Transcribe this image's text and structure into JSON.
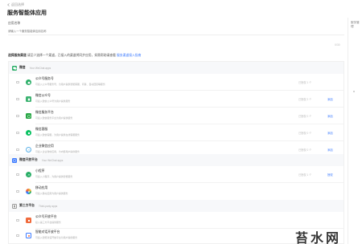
{
  "header": {
    "back_label": "返回选择",
    "title": "服务智能体应用"
  },
  "right_panel": {
    "label": "服务管理"
  },
  "form": {
    "name_label": "应用名称",
    "name_placeholder": "请输入一个服务智能体应用名称",
    "name_count": "0/30"
  },
  "selection": {
    "title": "选择服务渠道",
    "hint": "请至少选择一个渠道，已接入的渠道将同步应用，如需帮助请查看",
    "link": "服务渠道接入指南"
  },
  "groups": [
    {
      "title": "微信",
      "subtitle": "Your WeChat apps",
      "color": "#2aae67",
      "rows": [
        {
          "name": "公众号服务号",
          "desc": "可接入公众号服务号，为用户提供智能客服、问答、自动回复等服务",
          "status": "已授权 1 个",
          "action": "",
          "icon_color": "#2aae67"
        },
        {
          "name": "微信公众号",
          "desc": "可接入微信公众号为用户提供服务",
          "status": "已授权 2 个",
          "action": "添加",
          "icon_color": "#3cb371"
        },
        {
          "name": "微信服务平台",
          "desc": "可接入微信服务平台为用户提供服务",
          "status": "已授权 0 个",
          "action": "添加",
          "icon_color": "#28a745"
        },
        {
          "name": "微信客服",
          "desc": "可接入微信客服，为用户提供在线客服服务",
          "status": "已授权 0 个",
          "action": "添加",
          "icon_color": "#07c160"
        },
        {
          "name": "企业微信应用",
          "desc": "可接入企业微信应用，为内部用户提供服务",
          "status": "已授权 0 个",
          "action": "添加",
          "icon_color": "#5ab0e8"
        }
      ]
    },
    {
      "title": "微信开放平台",
      "subtitle": "Your WeChat apps",
      "color": "#3d7bff",
      "rows": [
        {
          "name": "小程序",
          "desc": "可接入小程序，为用户提供智能服务",
          "status": "已授权 1 个",
          "action": "授权",
          "icon_color": "#2aae67"
        },
        {
          "name": "移动应用",
          "desc": "可接入移动应用为用户提供服务",
          "status": "",
          "action": "",
          "icon_color": "#e8b43c"
        }
      ]
    },
    {
      "title": "第三方平台",
      "subtitle": "Third-party apps",
      "color": "#9a9a9a",
      "rows": [
        {
          "name": "公众号开放平台",
          "desc": "接入第三方平台提供服务",
          "status": "",
          "action": "",
          "icon_color": "#f06a3c"
        },
        {
          "name": "智能对话开放平台",
          "desc": "可接入智能对话开放平台为用户提供服务",
          "status": "",
          "action": "",
          "icon_color": "#3d7bff"
        }
      ]
    }
  ],
  "watermark": "苔水网"
}
